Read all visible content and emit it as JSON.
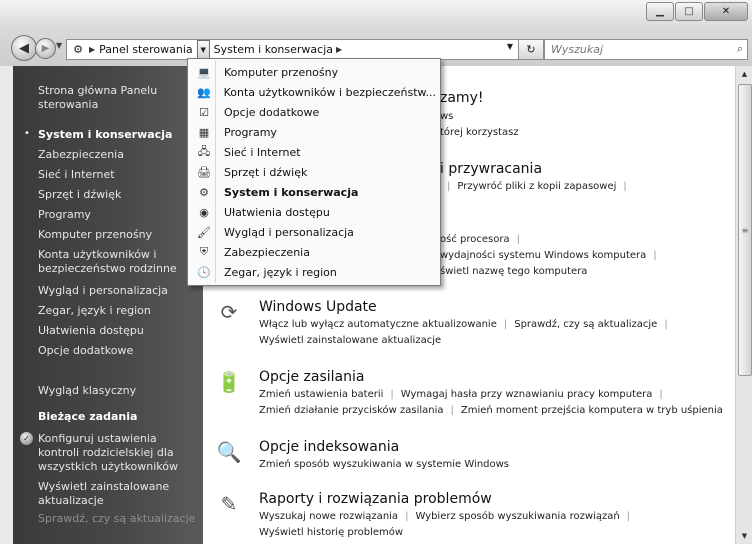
{
  "window": {
    "minimize_icon": "minimize-icon",
    "maximize_icon": "maximize-icon",
    "close_icon": "close-icon"
  },
  "address_bar": {
    "crumb_1": "Panel sterowania",
    "crumb_2": "System i konserwacja",
    "refresh_icon": "refresh-icon"
  },
  "search": {
    "placeholder": "Wyszukaj"
  },
  "dropdown": {
    "items": [
      {
        "label": "Komputer przenośny",
        "icon": "laptop-icon"
      },
      {
        "label": "Konta użytkowników i bezpieczeństw...",
        "icon": "users-icon"
      },
      {
        "label": "Opcje dodatkowe",
        "icon": "checkbox-icon"
      },
      {
        "label": "Programy",
        "icon": "programs-icon"
      },
      {
        "label": "Sieć i Internet",
        "icon": "network-icon"
      },
      {
        "label": "Sprzęt i dźwięk",
        "icon": "hardware-icon"
      },
      {
        "label": "System i konserwacja",
        "icon": "system-icon",
        "bold": true
      },
      {
        "label": "Ułatwienia dostępu",
        "icon": "accessibility-icon"
      },
      {
        "label": "Wygląd i personalizacja",
        "icon": "appearance-icon"
      },
      {
        "label": "Zabezpieczenia",
        "icon": "shield-icon"
      },
      {
        "label": "Zegar, język i region",
        "icon": "clock-icon"
      }
    ]
  },
  "sidebar": {
    "home_link": "Strona główna Panelu sterowania",
    "items": [
      "System i konserwacja",
      "Zabezpieczenia",
      "Sieć i Internet",
      "Sprzęt i dźwięk",
      "Programy",
      "Komputer przenośny",
      "Konta użytkowników i bezpieczeństwo rodzinne",
      "Wygląd i personalizacja",
      "Zegar, język i region",
      "Ułatwienia dostępu",
      "Opcje dodatkowe"
    ],
    "classic_view": "Wygląd klasyczny",
    "tasks_heading": "Bieżące zadania",
    "tasks": [
      "Konfiguruj ustawienia kontroli rodzicielskiej dla wszystkich użytkowników",
      "Wyświetl zainstalowane aktualizacje",
      "Sprawdź, czy są aktualizacje"
    ]
  },
  "main": {
    "welcome": {
      "title_partial": "zamy!",
      "line_1": "ws",
      "line_2": "tórej korzystasz"
    },
    "backup": {
      "title_partial": "i przywracania",
      "link": "Przywróć pliki z kopii zapasowej"
    },
    "system": {
      "line_1": "ość procesora",
      "line_2": "wydajności systemu Windows komputera",
      "line_3": "świetl nazwę tego komputera"
    },
    "windows_update": {
      "title": "Windows Update",
      "links_1": [
        "Włącz lub wyłącz automatyczne aktualizowanie",
        "Sprawdź, czy są aktualizacje"
      ],
      "links_2": [
        "Wyświetl zainstalowane aktualizacje"
      ]
    },
    "power": {
      "title": "Opcje zasilania",
      "links_1": [
        "Zmień ustawienia baterii",
        "Wymagaj hasła przy wznawianiu pracy komputera"
      ],
      "links_2": [
        "Zmień działanie przycisków zasilania",
        "Zmień moment przejścia komputera w tryb uśpienia"
      ]
    },
    "indexing": {
      "title": "Opcje indeksowania",
      "links_1": [
        "Zmień sposób wyszukiwania w systemie Windows"
      ]
    },
    "problems": {
      "title": "Raporty i rozwiązania problemów",
      "links_1": [
        "Wyszukaj nowe rozwiązania",
        "Wybierz sposób wyszukiwania rozwiązań"
      ],
      "links_2": [
        "Wyświetl historię problemów"
      ]
    }
  }
}
